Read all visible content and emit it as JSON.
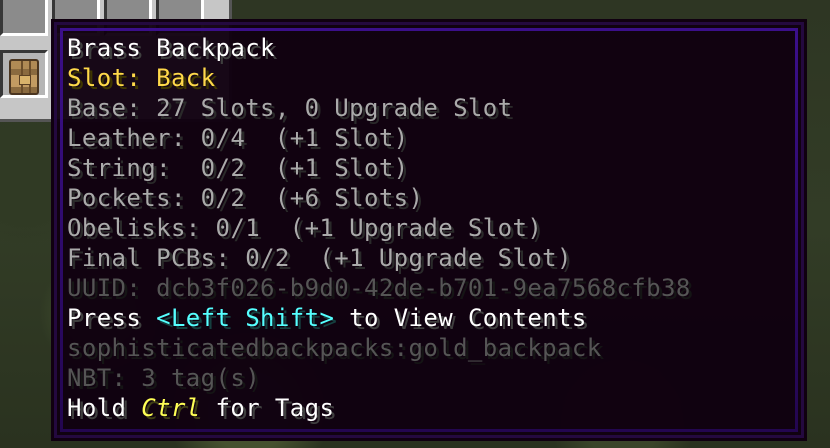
{
  "inventory": {
    "backpack_icon": "brass-backpack-icon"
  },
  "tooltip": {
    "title": "Brass Backpack",
    "slot": "Slot: Back",
    "base": "Base: 27 Slots, 0 Upgrade Slot",
    "leather": "Leather: 0/4  (+1 Slot)",
    "string": "String:  0/2  (+1 Slot)",
    "pockets": "Pockets: 0/2  (+6 Slots)",
    "obelisks": "Obelisks: 0/1  (+1 Upgrade Slot)",
    "final_pcbs": "Final PCBs: 0/2  (+1 Upgrade Slot)",
    "uuid": "UUID: dcb3f026-b9d0-42de-b701-9ea7568cfb38",
    "press_prefix": "Press ",
    "press_key": "<Left Shift>",
    "press_suffix": " to View Contents",
    "item_id": "sophisticatedbackpacks:gold_backpack",
    "nbt": "NBT: 3 tag(s)",
    "hold_prefix": "Hold ",
    "hold_key": "Ctrl",
    "hold_suffix": " for Tags"
  },
  "colors": {
    "tooltip_bg": "#100010",
    "tooltip_border": "#2a0d5c",
    "title": "#ffffff",
    "slot_text": "#ffd94a",
    "stat_text": "#aaaaaa",
    "meta_text": "#555555",
    "key_highlight": "#55ffff",
    "ctrl_highlight": "#ffff55"
  }
}
